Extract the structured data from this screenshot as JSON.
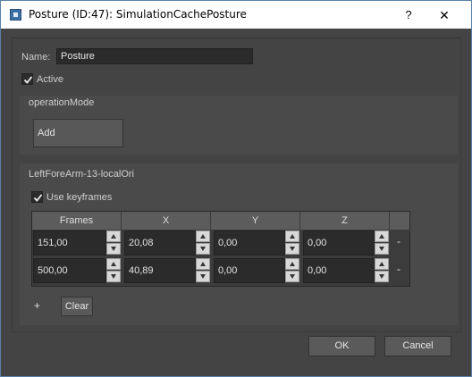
{
  "window": {
    "title": "Posture (ID:47): SimulationCachePosture",
    "help_label": "?",
    "close_label": "✕"
  },
  "name": {
    "label": "Name:",
    "value": "Posture"
  },
  "active": {
    "label": "Active",
    "checked": true
  },
  "operation_mode": {
    "title": "operationMode",
    "button_label": "Add"
  },
  "attribute_group": {
    "title": "LeftForeArm-13-localOri",
    "use_keyframes": {
      "label": "Use keyframes",
      "checked": true
    },
    "columns": [
      "Frames",
      "X",
      "Y",
      "Z"
    ],
    "rows": [
      {
        "frames": "151,00",
        "x": "20,08",
        "y": "0,00",
        "z": "0,00",
        "remove_label": "-"
      },
      {
        "frames": "500,00",
        "x": "40,89",
        "y": "0,00",
        "z": "0,00",
        "remove_label": "-"
      }
    ],
    "add_label": "+",
    "clear_label": "Clear"
  },
  "footer": {
    "ok_label": "OK",
    "cancel_label": "Cancel"
  },
  "colors": {
    "background": "#444444",
    "panel": "#4a4a4a",
    "field": "#2b2b2b",
    "accent_border": "#5a7fa8"
  },
  "icons": {
    "app": "app-window-icon",
    "check": "checkmark-icon"
  }
}
